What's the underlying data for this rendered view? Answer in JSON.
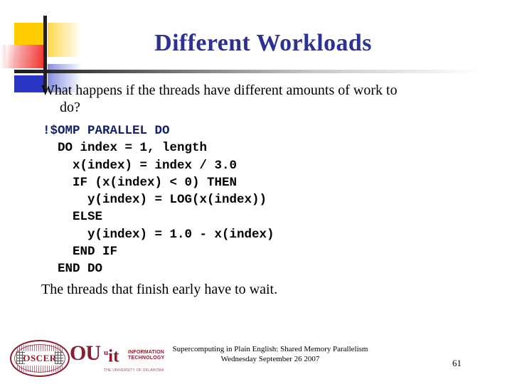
{
  "slide": {
    "title": "Different Workloads",
    "body_line1": "What happens if the threads have different amounts of work to",
    "body_line2": "do?",
    "closing": "The threads that finish early have to wait.",
    "page_number": "61"
  },
  "code": {
    "directive": "!$OMP PARALLEL DO",
    "lines": [
      "  DO index = 1, length",
      "    x(index) = index / 3.0",
      "    IF (x(index) < 0) THEN",
      "      y(index) = LOG(x(index))",
      "    ELSE",
      "      y(index) = 1.0 - x(index)",
      "    END IF",
      "  END DO"
    ],
    "body": "  DO index = 1, length\n    x(index) = index / 3.0\n    IF (x(index) < 0) THEN\n      y(index) = LOG(x(index))\n    ELSE\n      y(index) = 1.0 - x(index)\n    END IF\n  END DO"
  },
  "footer": {
    "line1": "Supercomputing in Plain English: Shared Memory Parallelism",
    "line2": "Wednesday September 26 2007"
  },
  "logos": {
    "oscer_text": "OSCER",
    "ou_text": "OU",
    "it_mark": "it",
    "it_sup": "u",
    "it_line1": "INFORMATION",
    "it_line2": "TECHNOLOGY",
    "it_line3": "THE UNIVERSITY OF OKLAHOMA"
  },
  "colors": {
    "title_navy": "#2E3192",
    "code_navy": "#16216B",
    "accent_yellow": "#FFCC00",
    "accent_red": "#F2312E",
    "accent_blue": "#2B35C4",
    "crimson": "#8C1D2E"
  }
}
